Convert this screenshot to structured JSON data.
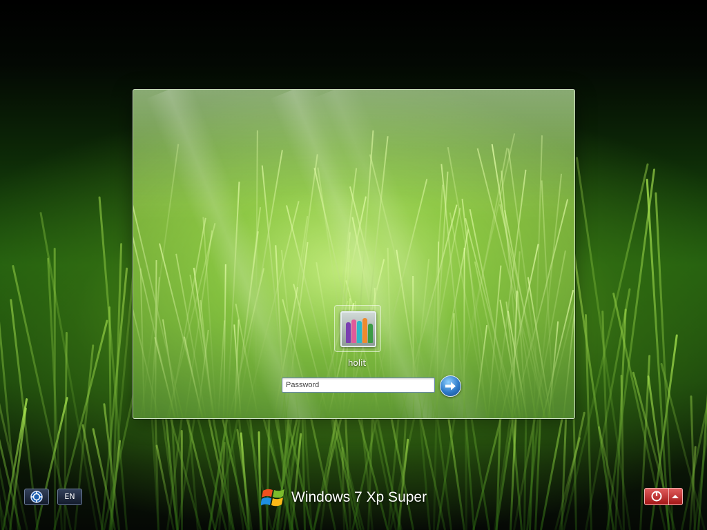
{
  "user": {
    "name": "holit"
  },
  "password": {
    "placeholder": "Password"
  },
  "language": {
    "code": "EN"
  },
  "branding": {
    "text": "Windows 7 Xp Super"
  },
  "icons": {
    "ease_of_access": "ease-of-access-icon",
    "go": "arrow-right-icon",
    "power": "power-icon",
    "power_menu": "chevron-up-icon",
    "windows_logo": "windows-logo-icon"
  },
  "colors": {
    "power_red": "#b31d1d",
    "go_blue": "#2d79c8",
    "grass_green": "#7fb240"
  }
}
